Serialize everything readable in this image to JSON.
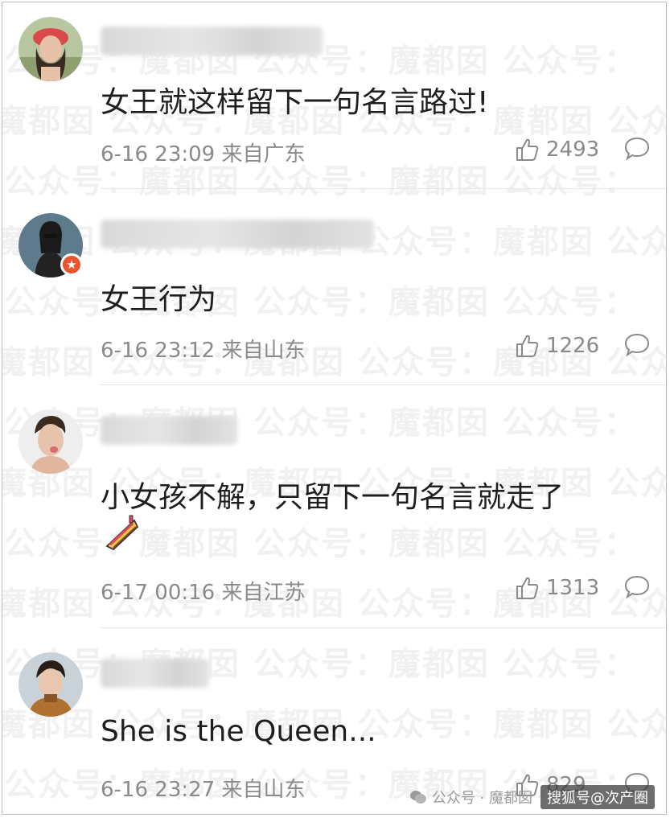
{
  "watermark": {
    "text": "魔都囡   公众号：魔都囡   公众号：魔都囡   公众号："
  },
  "comments": [
    {
      "text": "女王就这样留下一句名言路过!",
      "time": "6-16 23:09",
      "location": "来自广东",
      "likes": "2493",
      "emoji": ""
    },
    {
      "text": "女王行为",
      "time": "6-16 23:12",
      "location": "来自山东",
      "likes": "1226",
      "emoji": ""
    },
    {
      "text": "小女孩不解，只留下一句名言就走了",
      "time": "6-17 00:16",
      "location": "来自江苏",
      "likes": "1313",
      "emoji": "cake-emoji"
    },
    {
      "text": "She is the Queen...",
      "time": "6-16 23:27",
      "location": "来自山东",
      "likes": "829",
      "emoji": ""
    }
  ],
  "footer": {
    "wechat_label": "公众号 · 魔都囡",
    "source_tag": "搜狐号@次产圈"
  },
  "colors": {
    "meta_gray": "#8a8a8a",
    "badge_orange": "#e8542c"
  }
}
